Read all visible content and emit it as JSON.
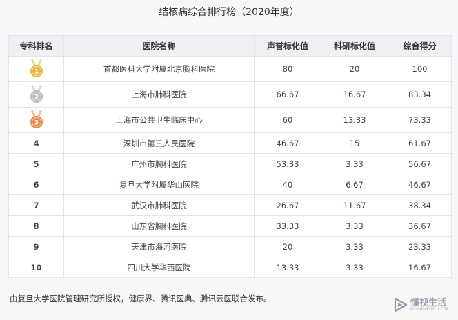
{
  "title": "结核病综合排行榜（2020年度）",
  "table": {
    "headers": [
      "专科排名",
      "医院名称",
      "声誉标化值",
      "科研标化值",
      "综合得分"
    ],
    "rows": [
      {
        "rank": "1",
        "name": "首都医科大学附属北京胸科医院",
        "reputation": "80",
        "research": "20",
        "total": "100",
        "medal": "gold"
      },
      {
        "rank": "2",
        "name": "上海市肺科医院",
        "reputation": "66.67",
        "research": "16.67",
        "total": "83.34",
        "medal": "silver"
      },
      {
        "rank": "3",
        "name": "上海市公共卫生临床中心",
        "reputation": "60",
        "research": "13.33",
        "total": "73.33",
        "medal": "bronze"
      },
      {
        "rank": "4",
        "name": "深圳市第三人民医院",
        "reputation": "46.67",
        "research": "15",
        "total": "61.67"
      },
      {
        "rank": "5",
        "name": "广州市胸科医院",
        "reputation": "53.33",
        "research": "3.33",
        "total": "56.67"
      },
      {
        "rank": "6",
        "name": "复旦大学附属华山医院",
        "reputation": "40",
        "research": "6.67",
        "total": "46.67"
      },
      {
        "rank": "7",
        "name": "武汉市肺科医院",
        "reputation": "26.67",
        "research": "11.67",
        "total": "38.34"
      },
      {
        "rank": "8",
        "name": "山东省胸科医院",
        "reputation": "33.33",
        "research": "3.33",
        "total": "36.67"
      },
      {
        "rank": "9",
        "name": "天津市海河医院",
        "reputation": "20",
        "research": "3.33",
        "total": "23.33"
      },
      {
        "rank": "10",
        "name": "四川大学华西医院",
        "reputation": "13.33",
        "research": "3.33",
        "total": "16.67"
      }
    ]
  },
  "footnote": "由复旦大学医院管理研究所授权，健康界、腾讯医典、腾讯云医联合发布。",
  "watermark": {
    "title": "懂视生活",
    "sub": "DDONGSHI.COM"
  },
  "colors": {
    "gold": "#e9b53a",
    "silver": "#b9bcc2",
    "bronze": "#e8884a",
    "header_bg": "#eef0f6"
  }
}
